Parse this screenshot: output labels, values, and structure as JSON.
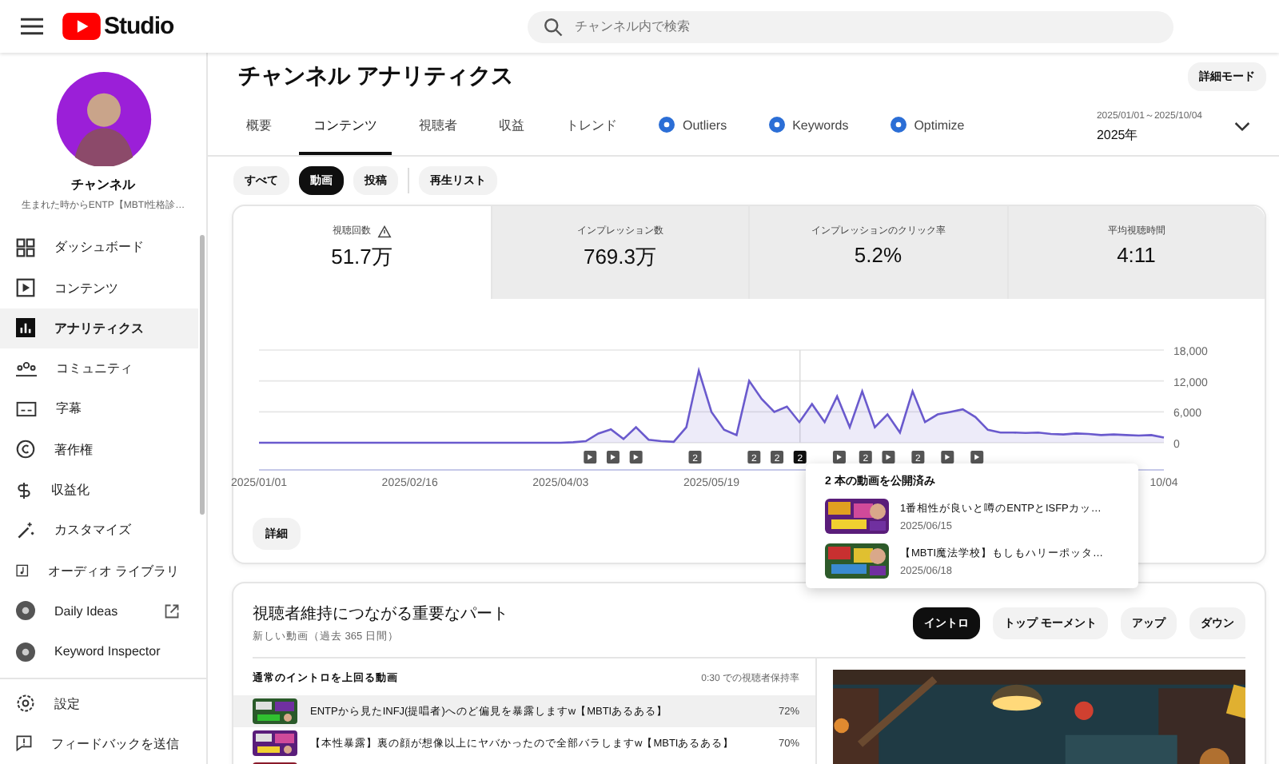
{
  "header": {
    "logo": "Studio",
    "search": {
      "placeholder": "チャンネル内で検索"
    }
  },
  "channel": {
    "name": "チャンネル",
    "description": "生まれた時からENTP【MBTI性格診…"
  },
  "sidebar": {
    "items": [
      {
        "label": "ダッシュボード",
        "selected": false
      },
      {
        "label": "コンテンツ",
        "selected": false
      },
      {
        "label": "アナリティクス",
        "selected": true
      },
      {
        "label": "コミュニティ",
        "selected": false
      },
      {
        "label": "字幕",
        "selected": false
      },
      {
        "label": "著作権",
        "selected": false
      },
      {
        "label": "収益化",
        "selected": false
      },
      {
        "label": "カスタマイズ",
        "selected": false
      },
      {
        "label": "オーディオ ライブラリ",
        "selected": false
      },
      {
        "label": "Daily Ideas",
        "selected": false,
        "external": true
      },
      {
        "label": "Keyword Inspector",
        "selected": false
      }
    ],
    "footer": [
      {
        "label": "設定"
      },
      {
        "label": "フィードバックを送信"
      }
    ]
  },
  "page": {
    "title": "チャンネル アナリティクス",
    "mode_button": "詳細モード"
  },
  "tabs": [
    {
      "label": "概要",
      "selected": false,
      "kind": "tab"
    },
    {
      "label": "コンテンツ",
      "selected": true,
      "kind": "tab"
    },
    {
      "label": "視聴者",
      "selected": false,
      "kind": "tab"
    },
    {
      "label": "収益",
      "selected": false,
      "kind": "tab"
    },
    {
      "label": "トレンド",
      "selected": false,
      "kind": "tab"
    },
    {
      "label": "Outliers",
      "selected": false,
      "kind": "extension"
    },
    {
      "label": "Keywords",
      "selected": false,
      "kind": "extension"
    },
    {
      "label": "Optimize",
      "selected": false,
      "kind": "extension"
    }
  ],
  "date_range": {
    "range": "2025/01/01～2025/10/04",
    "label": "2025年"
  },
  "filters": [
    {
      "label": "すべて",
      "selected": false
    },
    {
      "label": "動画",
      "selected": true
    },
    {
      "label": "投稿",
      "selected": false
    },
    {
      "label": "再生リスト",
      "selected": false
    }
  ],
  "metrics": [
    {
      "label": "視聴回数",
      "value": "51.7万",
      "selected": true,
      "warning": true
    },
    {
      "label": "インプレッション数",
      "value": "769.3万",
      "selected": false
    },
    {
      "label": "インプレッションのクリック率",
      "value": "5.2%",
      "selected": false
    },
    {
      "label": "平均視聴時間",
      "value": "4:11",
      "selected": false
    }
  ],
  "chart_data": {
    "type": "area",
    "categories": [
      "2025/01/01",
      null,
      null,
      null,
      null,
      null,
      null,
      null,
      null,
      null,
      null,
      null,
      "2025/02/16",
      null,
      null,
      null,
      null,
      null,
      null,
      null,
      null,
      null,
      null,
      null,
      "2025/04/03",
      null,
      null,
      null,
      null,
      null,
      null,
      null,
      null,
      null,
      null,
      null,
      "2025/05/19",
      null,
      null,
      null,
      null,
      null,
      null,
      null,
      null,
      null,
      null,
      null,
      null,
      null,
      null,
      null,
      null,
      null,
      null,
      null,
      null,
      null,
      null,
      null,
      null,
      null,
      null,
      null,
      null,
      null,
      null,
      null,
      null,
      null,
      null,
      null,
      "10/04"
    ],
    "series": [
      {
        "color": "#6a5acd",
        "values": [
          0,
          0,
          0,
          0,
          0,
          0,
          0,
          0,
          0,
          0,
          0,
          0,
          0,
          0,
          0,
          0,
          0,
          0,
          0,
          0,
          0,
          0,
          0,
          0,
          0,
          100,
          300,
          1800,
          2600,
          700,
          3000,
          600,
          300,
          200,
          3000,
          14000,
          6000,
          2500,
          1500,
          12000,
          8500,
          6000,
          7000,
          4000,
          7500,
          4000,
          9000,
          3000,
          10000,
          3000,
          5500,
          2000,
          10000,
          4000,
          5500,
          6000,
          6500,
          5000,
          2500,
          2000,
          2000,
          1900,
          2000,
          1700,
          1600,
          1800,
          1700,
          1500,
          1600,
          1500,
          1400,
          1500,
          1000
        ]
      }
    ],
    "ylim": [
      0,
      18000
    ],
    "yticks": [
      {
        "value": 0,
        "label": "0"
      },
      {
        "value": 6000,
        "label": "6,000"
      },
      {
        "value": 12000,
        "label": "12,000"
      },
      {
        "value": 18000,
        "label": "18,000"
      }
    ]
  },
  "release_markers": [
    {
      "kind": "single",
      "selected": false
    },
    {
      "kind": "single",
      "selected": false
    },
    {
      "kind": "single",
      "selected": false
    },
    {
      "kind": "multiple",
      "label": "2",
      "selected": false
    },
    {
      "kind": "multiple",
      "label": "2",
      "selected": false
    },
    {
      "kind": "multiple",
      "label": "2",
      "selected": false
    },
    {
      "kind": "multiple",
      "label": "2",
      "selected": true
    },
    {
      "kind": "single",
      "selected": false
    },
    {
      "kind": "multiple",
      "label": "2",
      "selected": false
    },
    {
      "kind": "single",
      "selected": false
    },
    {
      "kind": "multiple",
      "label": "2",
      "selected": false
    },
    {
      "kind": "single",
      "selected": false
    },
    {
      "kind": "single",
      "selected": false
    }
  ],
  "tooltip": {
    "title": "2 本の動画を公開済み",
    "videos": [
      {
        "title": "1番相性が良いと噂のENTPとISFPカッ…",
        "date": "2025/06/15"
      },
      {
        "title": "【MBTI魔法学校】もしもハリーポッタ…",
        "date": "2025/06/18"
      }
    ]
  },
  "details_button": "詳細",
  "retention": {
    "title": "視聴者維持につながる重要なパート",
    "subtitle": "新しい動画（過去 365 日間）",
    "chips": [
      {
        "label": "イントロ",
        "selected": true
      },
      {
        "label": "トップ モーメント",
        "selected": false
      },
      {
        "label": "アップ",
        "selected": false
      },
      {
        "label": "ダウン",
        "selected": false
      }
    ],
    "columns": [
      "通常のイントロを上回る動画",
      "0:30 での視聴者保持率"
    ],
    "rows": [
      {
        "title": "ENTPから見たINFJ(提唱者)へのど偏見を暴露しますw【MBTIあるある】",
        "value": "72%",
        "selected": true
      },
      {
        "title": "【本性暴露】裏の顔が想像以上にヤバかったので全部バラしますw【MBTIあるある】",
        "value": "70%",
        "selected": false
      },
      {
        "kind": "cut"
      }
    ]
  }
}
